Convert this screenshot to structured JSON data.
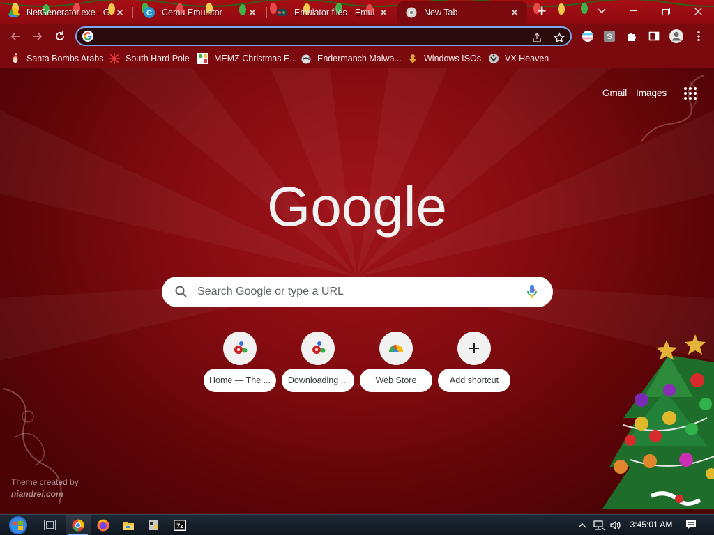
{
  "browser": {
    "tabs": [
      {
        "title": "NetGenerator.exe - Go",
        "icon": "google-drive-icon",
        "active": false
      },
      {
        "title": "Cemu Emulator",
        "icon": "cemu-icon",
        "active": false
      },
      {
        "title": "Emulator files - Emulat",
        "icon": "emulator-site-icon",
        "active": false
      },
      {
        "title": "New Tab",
        "icon": "chrome-icon",
        "active": true
      }
    ],
    "new_tab_label": "+",
    "omnibox": {
      "value": "",
      "placeholder": ""
    },
    "bookmarks": [
      {
        "label": "Santa Bombs Arabs",
        "icon": "santa-icon"
      },
      {
        "label": "South Hard Pole",
        "icon": "snowflake-icon"
      },
      {
        "label": "MEMZ Christmas E...",
        "icon": "memz-icon"
      },
      {
        "label": "Endermanch Malwa...",
        "icon": "raccoon-icon"
      },
      {
        "label": "Windows ISOs",
        "icon": "windows-isos-icon"
      },
      {
        "label": "VX Heaven",
        "icon": "vx-heaven-icon"
      }
    ]
  },
  "ntp": {
    "top_links": {
      "gmail": "Gmail",
      "images": "Images"
    },
    "logo_text": "Google",
    "search_placeholder": "Search Google or type a URL",
    "shortcuts": [
      {
        "label": "Home — The ...",
        "icon": "gears-icon"
      },
      {
        "label": "Downloading ...",
        "icon": "gears-icon"
      },
      {
        "label": "Web Store",
        "icon": "web-store-icon"
      },
      {
        "label": "Add shortcut",
        "icon": "plus-icon"
      }
    ],
    "theme_credit": {
      "line1": "Theme created by",
      "line2": "niandrei.com"
    }
  },
  "taskbar": {
    "apps": [
      "start-orb-icon",
      "task-view-icon",
      "chrome-icon",
      "firefox-icon",
      "file-explorer-icon",
      "app-icon",
      "7zip-icon"
    ],
    "clock": "3:45:01 AM"
  },
  "colors": {
    "accent_focus": "#7aa7f0",
    "theme_red": "#7b0a0e",
    "tabstrip_red": "#a80e14"
  }
}
